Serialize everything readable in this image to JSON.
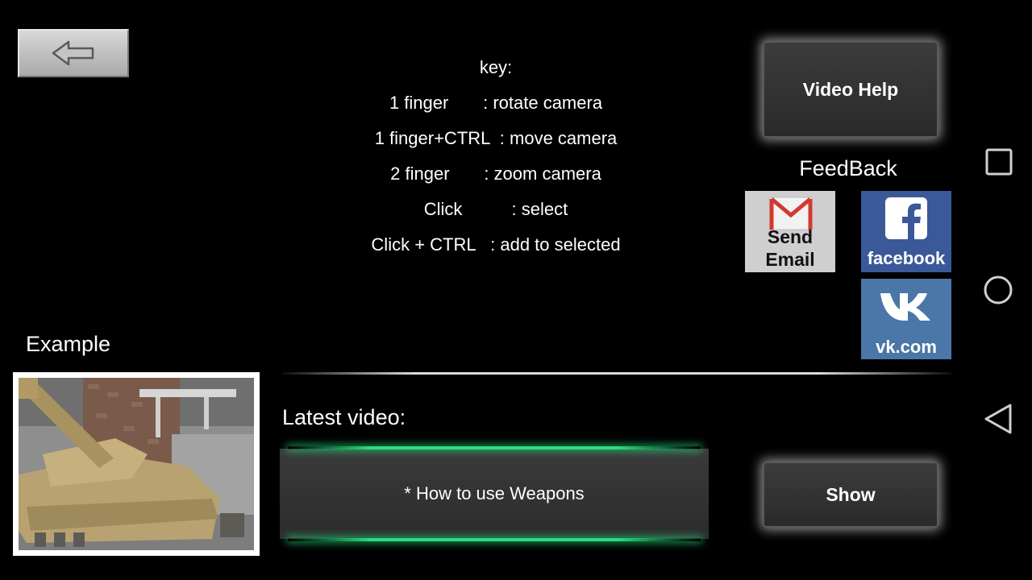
{
  "key_help": {
    "title": "key:",
    "lines": [
      "1 finger       : rotate camera",
      "1 finger+CTRL  : move camera",
      "2 finger       : zoom camera",
      "Click          : select",
      "Click + CTRL   : add to selected"
    ]
  },
  "buttons": {
    "video_help": "Video Help",
    "show": "Show"
  },
  "feedback": {
    "title": "FeedBack",
    "email_label": "Send Email",
    "facebook_label": "facebook",
    "vk_label": "vk.com"
  },
  "example": {
    "title": "Example"
  },
  "latest_video": {
    "title": "Latest video:",
    "item": "* How to use Weapons"
  },
  "icons": {
    "back": "arrow-left-icon",
    "email": "gmail-icon",
    "facebook": "facebook-icon",
    "vk": "vk-icon",
    "nav_recent": "square-icon",
    "nav_home": "circle-icon",
    "nav_back": "triangle-back-icon"
  },
  "colors": {
    "background": "#000000",
    "facebook": "#3b5998",
    "vk": "#4a76a8",
    "accent_green": "#25e07e"
  }
}
